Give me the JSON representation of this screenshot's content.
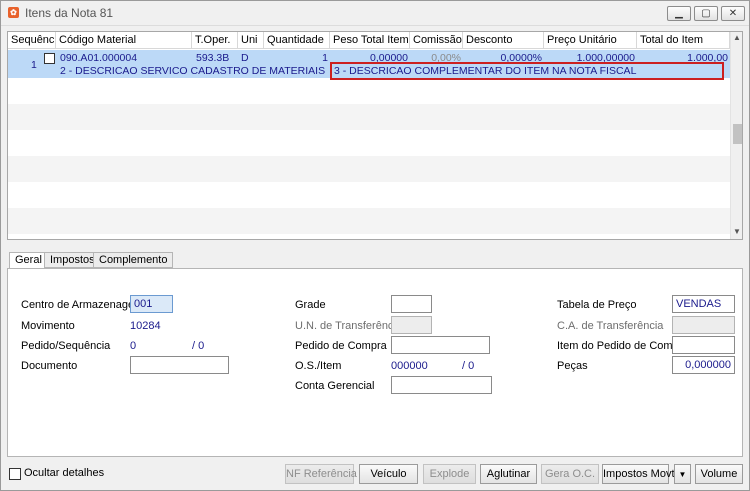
{
  "window": {
    "title": "Itens da Nota 81",
    "app_icon": "app-logo-icon"
  },
  "grid": {
    "columns": [
      "Sequência",
      "Código Material",
      "T.Oper.",
      "Uni",
      "Quantidade",
      "Peso Total Item",
      "Comissão",
      "Desconto",
      "Preço Unitário",
      "Total do Item"
    ],
    "rows": [
      {
        "sequencia": "1",
        "codigo": "090.A01.000004",
        "toper": "593.3B",
        "uni": "D",
        "quantidade": "1",
        "peso_total": "0,00000",
        "comissao": "0,00%",
        "desconto": "0,0000%",
        "preco_unitario": "1.000,00000",
        "total_item": "1.000,00",
        "descricao": "2 - DESCRICAO SERVICO CADASTRO DE MATERIAIS",
        "descricao_complementar": "3 - DESCRICAO COMPLEMENTAR DO ITEM NA NOTA FISCAL"
      }
    ]
  },
  "tabs": [
    {
      "label": "Geral",
      "active": true
    },
    {
      "label": "Impostos",
      "active": false
    },
    {
      "label": "Complemento",
      "active": false
    }
  ],
  "form": {
    "centro_armazenagem": {
      "label": "Centro de Armazenagem",
      "value": "001"
    },
    "movimento": {
      "label": "Movimento",
      "value": "10284"
    },
    "pedido_sequencia": {
      "label": "Pedido/Sequência",
      "value": "0",
      "sep": "/ 0"
    },
    "documento": {
      "label": "Documento",
      "value": ""
    },
    "grade": {
      "label": "Grade",
      "value": ""
    },
    "un_transferencia": {
      "label": "U.N. de Transferência",
      "value": ""
    },
    "pedido_compra": {
      "label": "Pedido de Compra",
      "value": ""
    },
    "os_item": {
      "label": "O.S./Item",
      "value": "000000",
      "sep": "/ 0"
    },
    "conta_gerencial": {
      "label": "Conta Gerencial",
      "value": ""
    },
    "tabela_preco": {
      "label": "Tabela de Preço",
      "value": "VENDAS"
    },
    "ca_transferencia": {
      "label": "C.A. de Transferência",
      "value": ""
    },
    "item_pedido_compra": {
      "label": "Item do Pedido de Compra",
      "value": ""
    },
    "pecas": {
      "label": "Peças",
      "value": "0,000000"
    }
  },
  "footer": {
    "ocultar_detalhes": "Ocultar detalhes",
    "buttons": {
      "nf_referencia": "NF Referência",
      "veiculo": "Veículo",
      "explode": "Explode",
      "aglutinar": "Aglutinar",
      "gera_oc": "Gera O.C.",
      "impostos_movto": "Impostos Movto",
      "volume": "Volume"
    }
  }
}
